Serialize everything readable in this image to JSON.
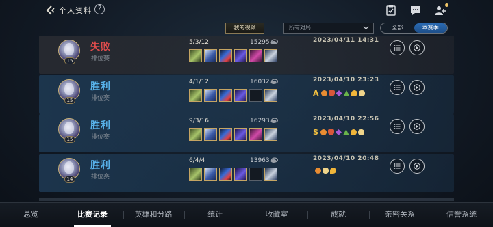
{
  "header": {
    "title": "个人资料",
    "help_label": "?",
    "icons": [
      "back-icon",
      "help-icon",
      "clipboard-check-icon",
      "chat-icon",
      "friends-icon"
    ]
  },
  "filters": {
    "videos_label": "我的视频",
    "match_filter_value": "所有对局",
    "season_options": [
      "全部",
      "本赛季"
    ],
    "season_selected": "本赛季"
  },
  "matches": [
    {
      "result": "失败",
      "mode": "排位赛",
      "level": "15",
      "kda": "5/3/12",
      "score": "15295",
      "datetime": "2023/04/11 14:31",
      "grade": "",
      "items": [
        "itm-0",
        "itm-1",
        "itm-2",
        "itm-3",
        "itm-4",
        "itm-5"
      ],
      "emblems": []
    },
    {
      "result": "胜利",
      "mode": "排位赛",
      "level": "15",
      "kda": "4/1/12",
      "score": "16032",
      "datetime": "2023/04/10 23:23",
      "grade": "A",
      "items": [
        "itm-0",
        "itm-1",
        "itm-2",
        "itm-3",
        "empty",
        "itm-5"
      ],
      "emblems": [
        "em-orange",
        "em-red",
        "em-purple",
        "em-green",
        "em-gold",
        "em-cream"
      ]
    },
    {
      "result": "胜利",
      "mode": "排位赛",
      "level": "15",
      "kda": "9/3/16",
      "score": "16293",
      "datetime": "2023/04/10 22:56",
      "grade": "S",
      "items": [
        "itm-0",
        "itm-1",
        "itm-2",
        "itm-3",
        "itm-4",
        "itm-5"
      ],
      "emblems": [
        "em-orange",
        "em-red",
        "em-purple",
        "em-green",
        "em-gold",
        "em-cream"
      ]
    },
    {
      "result": "胜利",
      "mode": "排位赛",
      "level": "14",
      "kda": "6/4/4",
      "score": "13963",
      "datetime": "2023/04/10 20:48",
      "grade": "",
      "items": [
        "itm-0",
        "itm-1",
        "itm-2",
        "itm-3",
        "empty",
        "itm-5"
      ],
      "emblems": [
        "em-orange",
        "em-cream",
        "em-gold"
      ]
    }
  ],
  "tabs": [
    "总览",
    "比赛记录",
    "英雄和分路",
    "统计",
    "收藏室",
    "成就",
    "亲密关系",
    "信誉系统"
  ],
  "active_tab": "比赛记录",
  "colors": {
    "loss": "#e04c4c",
    "win": "#58b2ea",
    "accent": "#2a6ab2",
    "item_border": "#c5a563"
  }
}
